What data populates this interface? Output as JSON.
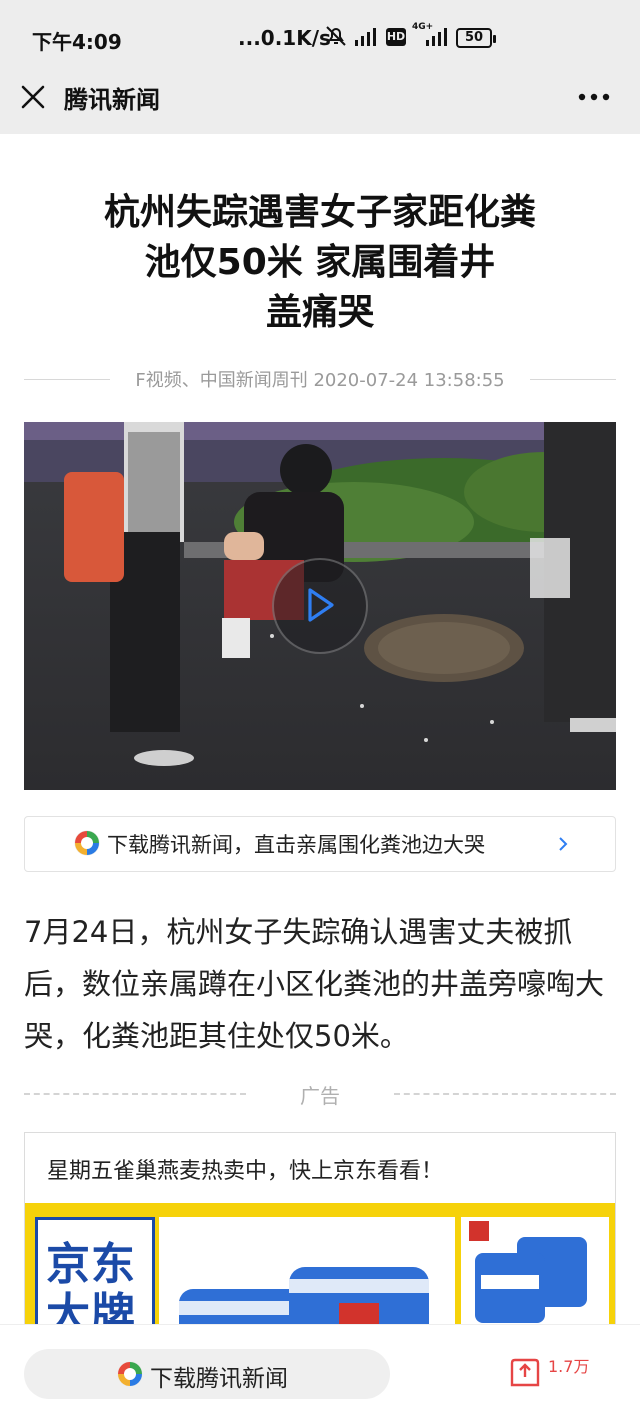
{
  "status_bar": {
    "time": "下午4:09",
    "network_speed": "...0.1K/s",
    "hd_label": "HD",
    "network_type": "4G+",
    "battery": "50",
    "icons": [
      "mute-icon",
      "signal-icon",
      "hd-icon",
      "signal-4g-icon",
      "battery-icon"
    ]
  },
  "nav": {
    "title": "腾讯新闻",
    "close_icon": "close-icon",
    "more_icon": "more-icon"
  },
  "article": {
    "headline_lines": [
      "杭州失踪遇害女子家距化粪",
      "池仅50米 家属围着井",
      "盖痛哭"
    ],
    "meta": "F视频、中国新闻周刊 2020-07-24 13:58:55",
    "body": "7月24日，杭州女子失踪确认遇害丈夫被抓后，数位亲属蹲在小区化粪池的井盖旁嚎啕大哭，化粪池距其住处仅50米。"
  },
  "video": {
    "play_icon": "play-icon",
    "accent_color": "#2f7ef2"
  },
  "download_banner": {
    "text": "下载腾讯新闻，直击亲属围化粪池边大哭",
    "icon": "tencent-news-logo-icon",
    "chevron_icon": "chevron-right-icon"
  },
  "ad": {
    "label": "广告",
    "title": "星期五雀巢燕麦热卖中，快上京东看看！",
    "brand_text": "京东大牌",
    "brand_color": "#1b4aa7",
    "banner_color": "#f6d20a"
  },
  "bottom_bar": {
    "download_label": "下载腾讯新闻",
    "share_count": "1.7万",
    "share_icon": "share-icon",
    "accent_color": "#e64545"
  }
}
